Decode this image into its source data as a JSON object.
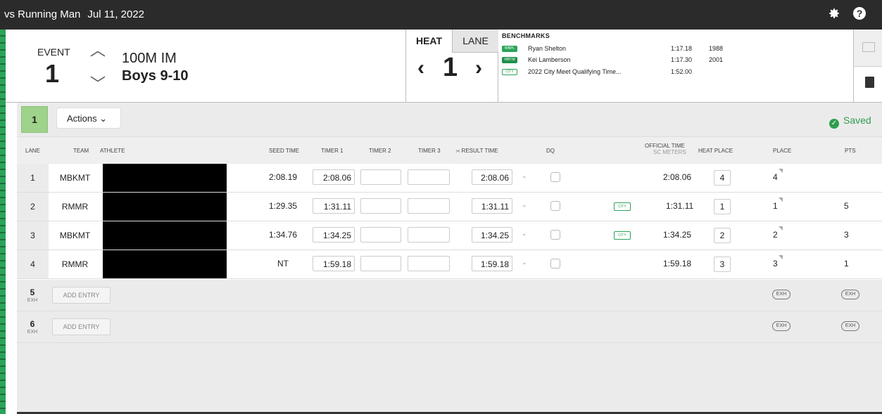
{
  "topbar": {
    "title": "vs Running Man",
    "date": "Jul 11, 2022"
  },
  "event": {
    "label": "EVENT",
    "number": "1",
    "name": "100M IM",
    "group": "Boys 9-10"
  },
  "heat": {
    "heat_tab": "HEAT",
    "lane_tab": "LANE",
    "number": "1"
  },
  "benchmarks": {
    "title": "BENCHMARKS",
    "items": [
      {
        "tag": "WBPL",
        "name": "Ryan Shelton",
        "time": "1:17.18",
        "year": "1988"
      },
      {
        "tag": "WBTM",
        "name": "Kei Lamberson",
        "time": "1:17.30",
        "year": "2001"
      },
      {
        "tag": "CITY",
        "name": "2022 City Meet Qualifying Time...",
        "time": "1:52.00",
        "year": ""
      }
    ]
  },
  "actionbar": {
    "heat_number": "1",
    "actions_label": "Actions ⌄",
    "saved_label": "Saved"
  },
  "columns": {
    "lane": "LANE",
    "team": "TEAM",
    "athlete": "ATHLETE",
    "seed": "SEED TIME",
    "t1": "TIMER 1",
    "t2": "TIMER 2",
    "t3": "TIMER 3",
    "result": "›‹ RESULT TIME",
    "dq": "DQ",
    "official": "OFFICIAL TIME",
    "official_sub": "SC METERS",
    "heat_place": "HEAT PLACE",
    "place": "PLACE",
    "pts": "PTS"
  },
  "rows": [
    {
      "lane": "1",
      "team": "MBKMT",
      "seed": "2:08.19",
      "t1": "2:08.06",
      "result": "2:08.06",
      "official": "2:08.06",
      "heat_place": "4",
      "place": "4",
      "pts": "",
      "city": ""
    },
    {
      "lane": "2",
      "team": "RMMR",
      "seed": "1:29.35",
      "t1": "1:31.11",
      "result": "1:31.11",
      "official": "1:31.11",
      "heat_place": "1",
      "place": "1",
      "pts": "5",
      "city": "CITY"
    },
    {
      "lane": "3",
      "team": "MBKMT",
      "seed": "1:34.76",
      "t1": "1:34.25",
      "result": "1:34.25",
      "official": "1:34.25",
      "heat_place": "2",
      "place": "2",
      "pts": "3",
      "city": "CITY"
    },
    {
      "lane": "4",
      "team": "RMMR",
      "seed": "NT",
      "t1": "1:59.18",
      "result": "1:59.18",
      "official": "1:59.18",
      "heat_place": "3",
      "place": "3",
      "pts": "1",
      "city": ""
    }
  ],
  "entries": [
    {
      "lane": "5",
      "sub": "EXH",
      "add": "ADD ENTRY",
      "exh": "EXH"
    },
    {
      "lane": "6",
      "sub": "EXH",
      "add": "ADD ENTRY",
      "exh": "EXH"
    }
  ],
  "icons": {
    "settings": "gear-icon",
    "help": "help-icon",
    "up": "chevron-up-icon",
    "down": "chevron-down-icon",
    "prev": "chevron-left-icon",
    "next": "chevron-right-icon",
    "saved": "check-circle-icon",
    "scoreboard": "podium-icon",
    "book": "book-icon"
  },
  "colors": {
    "topbar": "#2b2b2b",
    "accent_green": "#2e9e4e",
    "heat_square": "#9fd28a"
  }
}
